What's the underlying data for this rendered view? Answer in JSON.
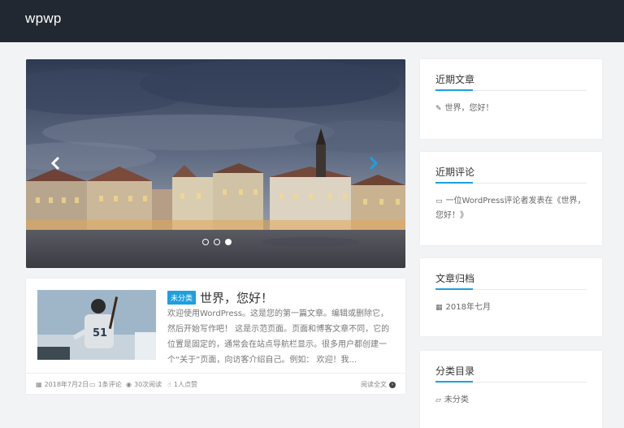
{
  "site": {
    "brand": "wpwp"
  },
  "slider": {
    "prev_glyph": "‹",
    "next_glyph": "›",
    "slides": 3,
    "active_slide": 3
  },
  "post": {
    "category": "未分类",
    "title": "世界，您好！",
    "excerpt": "欢迎使用WordPress。这是您的第一篇文章。编辑或删除它，然后开始写作吧！ 这是示范页面。页面和博客文章不同，它的位置是固定的，通常会在站点导航栏显示。很多用户都创建一个“关于”页面，向访客介绍自己。例如： 欢迎！我...",
    "date": "2018年7月2日",
    "comments": "1条评论",
    "views": "30次阅读",
    "likes": "1人点赞",
    "read_more": "阅读全文"
  },
  "widgets": {
    "recent_posts": {
      "title": "近期文章",
      "items": [
        "世界，您好！"
      ]
    },
    "recent_comments": {
      "title": "近期评论",
      "items": [
        "一位WordPress评论者发表在《世界，您好！》"
      ]
    },
    "archives": {
      "title": "文章归档",
      "items": [
        "2018年七月"
      ]
    },
    "categories": {
      "title": "分类目录",
      "items": [
        "未分类"
      ]
    }
  },
  "colors": {
    "topbar": "#222831",
    "accent": "#1e9fe0",
    "background": "#f2f3f5"
  }
}
